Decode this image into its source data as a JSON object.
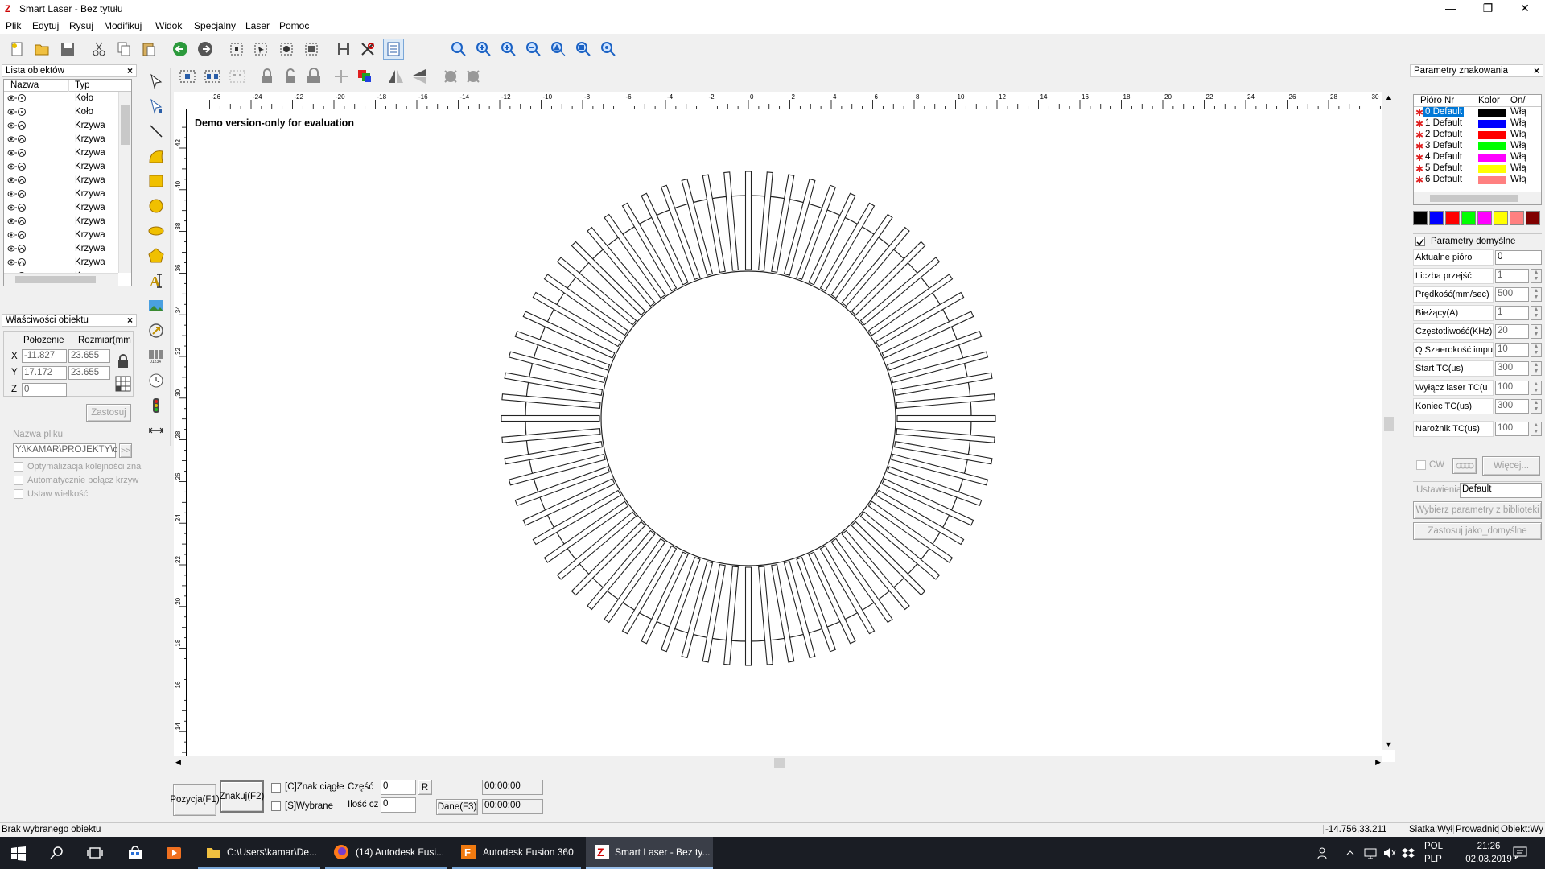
{
  "window": {
    "title": "Smart Laser - Bez tytułu",
    "minimize": "—",
    "maximize": "❐",
    "close": "✕"
  },
  "menu": [
    "Plik",
    "Edytuj",
    "Rysuj",
    "Modifikuj",
    "Widok",
    "Specjalny",
    "Laser",
    "Pomoc"
  ],
  "object_list": {
    "title": "Lista obiektów",
    "col_name": "Nazwa",
    "col_type": "Typ",
    "rows": [
      "Koło",
      "Koło",
      "Krzywa",
      "Krzywa",
      "Krzywa",
      "Krzywa",
      "Krzywa",
      "Krzywa",
      "Krzywa",
      "Krzywa",
      "Krzywa",
      "Krzywa",
      "Krzywa",
      "Krzywa"
    ]
  },
  "properties": {
    "title": "Właściwości obiektu",
    "position_label": "Położenie",
    "size_label": "Rozmiar(mm",
    "x_label": "X",
    "y_label": "Y",
    "z_label": "Z",
    "x_pos": "-11.827",
    "x_size": "23.655",
    "y_pos": "17.172",
    "y_size": "23.655",
    "z_pos": "0",
    "apply": "Zastosuj",
    "filename_label": "Nazwa pliku",
    "filename": "Y:\\KAMAR\\PROJEKTY\\c",
    "browse": ">>",
    "opt1": "Optymalizacja kolejności zna",
    "opt2": "Automatycznie połącz krzyw",
    "opt3": "Ustaw wielkość"
  },
  "canvas": {
    "watermark": "Demo version-only for evaluation"
  },
  "ruler_top": [
    "-26",
    "-24",
    "-22",
    "-20",
    "-18",
    "-16",
    "-14",
    "-12",
    "-10",
    "-8",
    "-6",
    "-4",
    "-2",
    "0",
    "2",
    "4",
    "6",
    "8",
    "10",
    "12",
    "14",
    "16",
    "18",
    "20",
    "22",
    "24",
    "26",
    "28",
    "30"
  ],
  "ruler_left": [
    "42",
    "40",
    "38",
    "36",
    "34",
    "32",
    "30",
    "28",
    "26",
    "24",
    "22",
    "20",
    "18",
    "16",
    "14"
  ],
  "bottom": {
    "position_btn": "Pozycja(F1)",
    "mark_btn": "Znakuj(F2)",
    "continuous": "[C]Znak ciągłe",
    "selected": "[S]Wybrane",
    "part_label": "Część",
    "part_value": "0",
    "count_label": "Ilość cz",
    "count_value": "0",
    "r_btn": "R",
    "data_btn": "Dane(F3)",
    "time1": "00:00:00",
    "time2": "00:00:00"
  },
  "marking": {
    "title": "Parametry znakowania",
    "col_pen": "Pióro Nr",
    "col_color": "Kolor",
    "col_onoff": "On/",
    "pens": [
      {
        "label": "0 Default",
        "color": "#000000",
        "on": "Włą"
      },
      {
        "label": "1 Default",
        "color": "#0000ff",
        "on": "Włą"
      },
      {
        "label": "2 Default",
        "color": "#ff0000",
        "on": "Włą"
      },
      {
        "label": "3 Default",
        "color": "#00ff00",
        "on": "Włą"
      },
      {
        "label": "4 Default",
        "color": "#ff00ff",
        "on": "Włą"
      },
      {
        "label": "5 Default",
        "color": "#ffff00",
        "on": "Włą"
      },
      {
        "label": "6 Default",
        "color": "#ff8080",
        "on": "Włą"
      }
    ],
    "palette": [
      "#000000",
      "#0000ff",
      "#ff0000",
      "#00ff00",
      "#ff00ff",
      "#ffff00",
      "#ff8080",
      "#800000"
    ],
    "default_params": "Parametry domyślne",
    "params": [
      {
        "label": "Aktualne pióro",
        "value": "0"
      },
      {
        "label": "Liczba przejść",
        "value": "1"
      },
      {
        "label": "Prędkość(mm/sec)",
        "value": "500"
      },
      {
        "label": "Bieżący(A)",
        "value": "1"
      },
      {
        "label": "Częstotliwość(KHz)",
        "value": "20"
      },
      {
        "label": "Q Szaerokość impu",
        "value": "10"
      },
      {
        "label": "Start TC(us)",
        "value": "300"
      },
      {
        "label": "Wyłącz laser TC(u",
        "value": "100"
      },
      {
        "label": "Koniec TC(us)",
        "value": "300"
      },
      {
        "label": "Narożnik TC(us)",
        "value": "100"
      }
    ],
    "cw": "CW",
    "more": "Więcej...",
    "settings_label": "Ustawienia",
    "settings_value": "Default",
    "choose_lib": "Wybierz parametry z biblioteki",
    "apply_default": "Zastosuj jako_domyślne"
  },
  "status": {
    "message": "Brak wybranego obiektu",
    "coords": "-14.756,33.211",
    "grid": "Siatka:Wył",
    "guide": "Prowadnic",
    "object": "Obiekt:Wy"
  },
  "taskbar": {
    "items": [
      "C:\\Users\\kamar\\De...",
      "(14) Autodesk Fusi...",
      "Autodesk Fusion 360",
      "Smart Laser - Bez ty..."
    ],
    "lang1": "POL",
    "lang2": "PLP",
    "time": "21:26",
    "date": "02.03.2019"
  }
}
